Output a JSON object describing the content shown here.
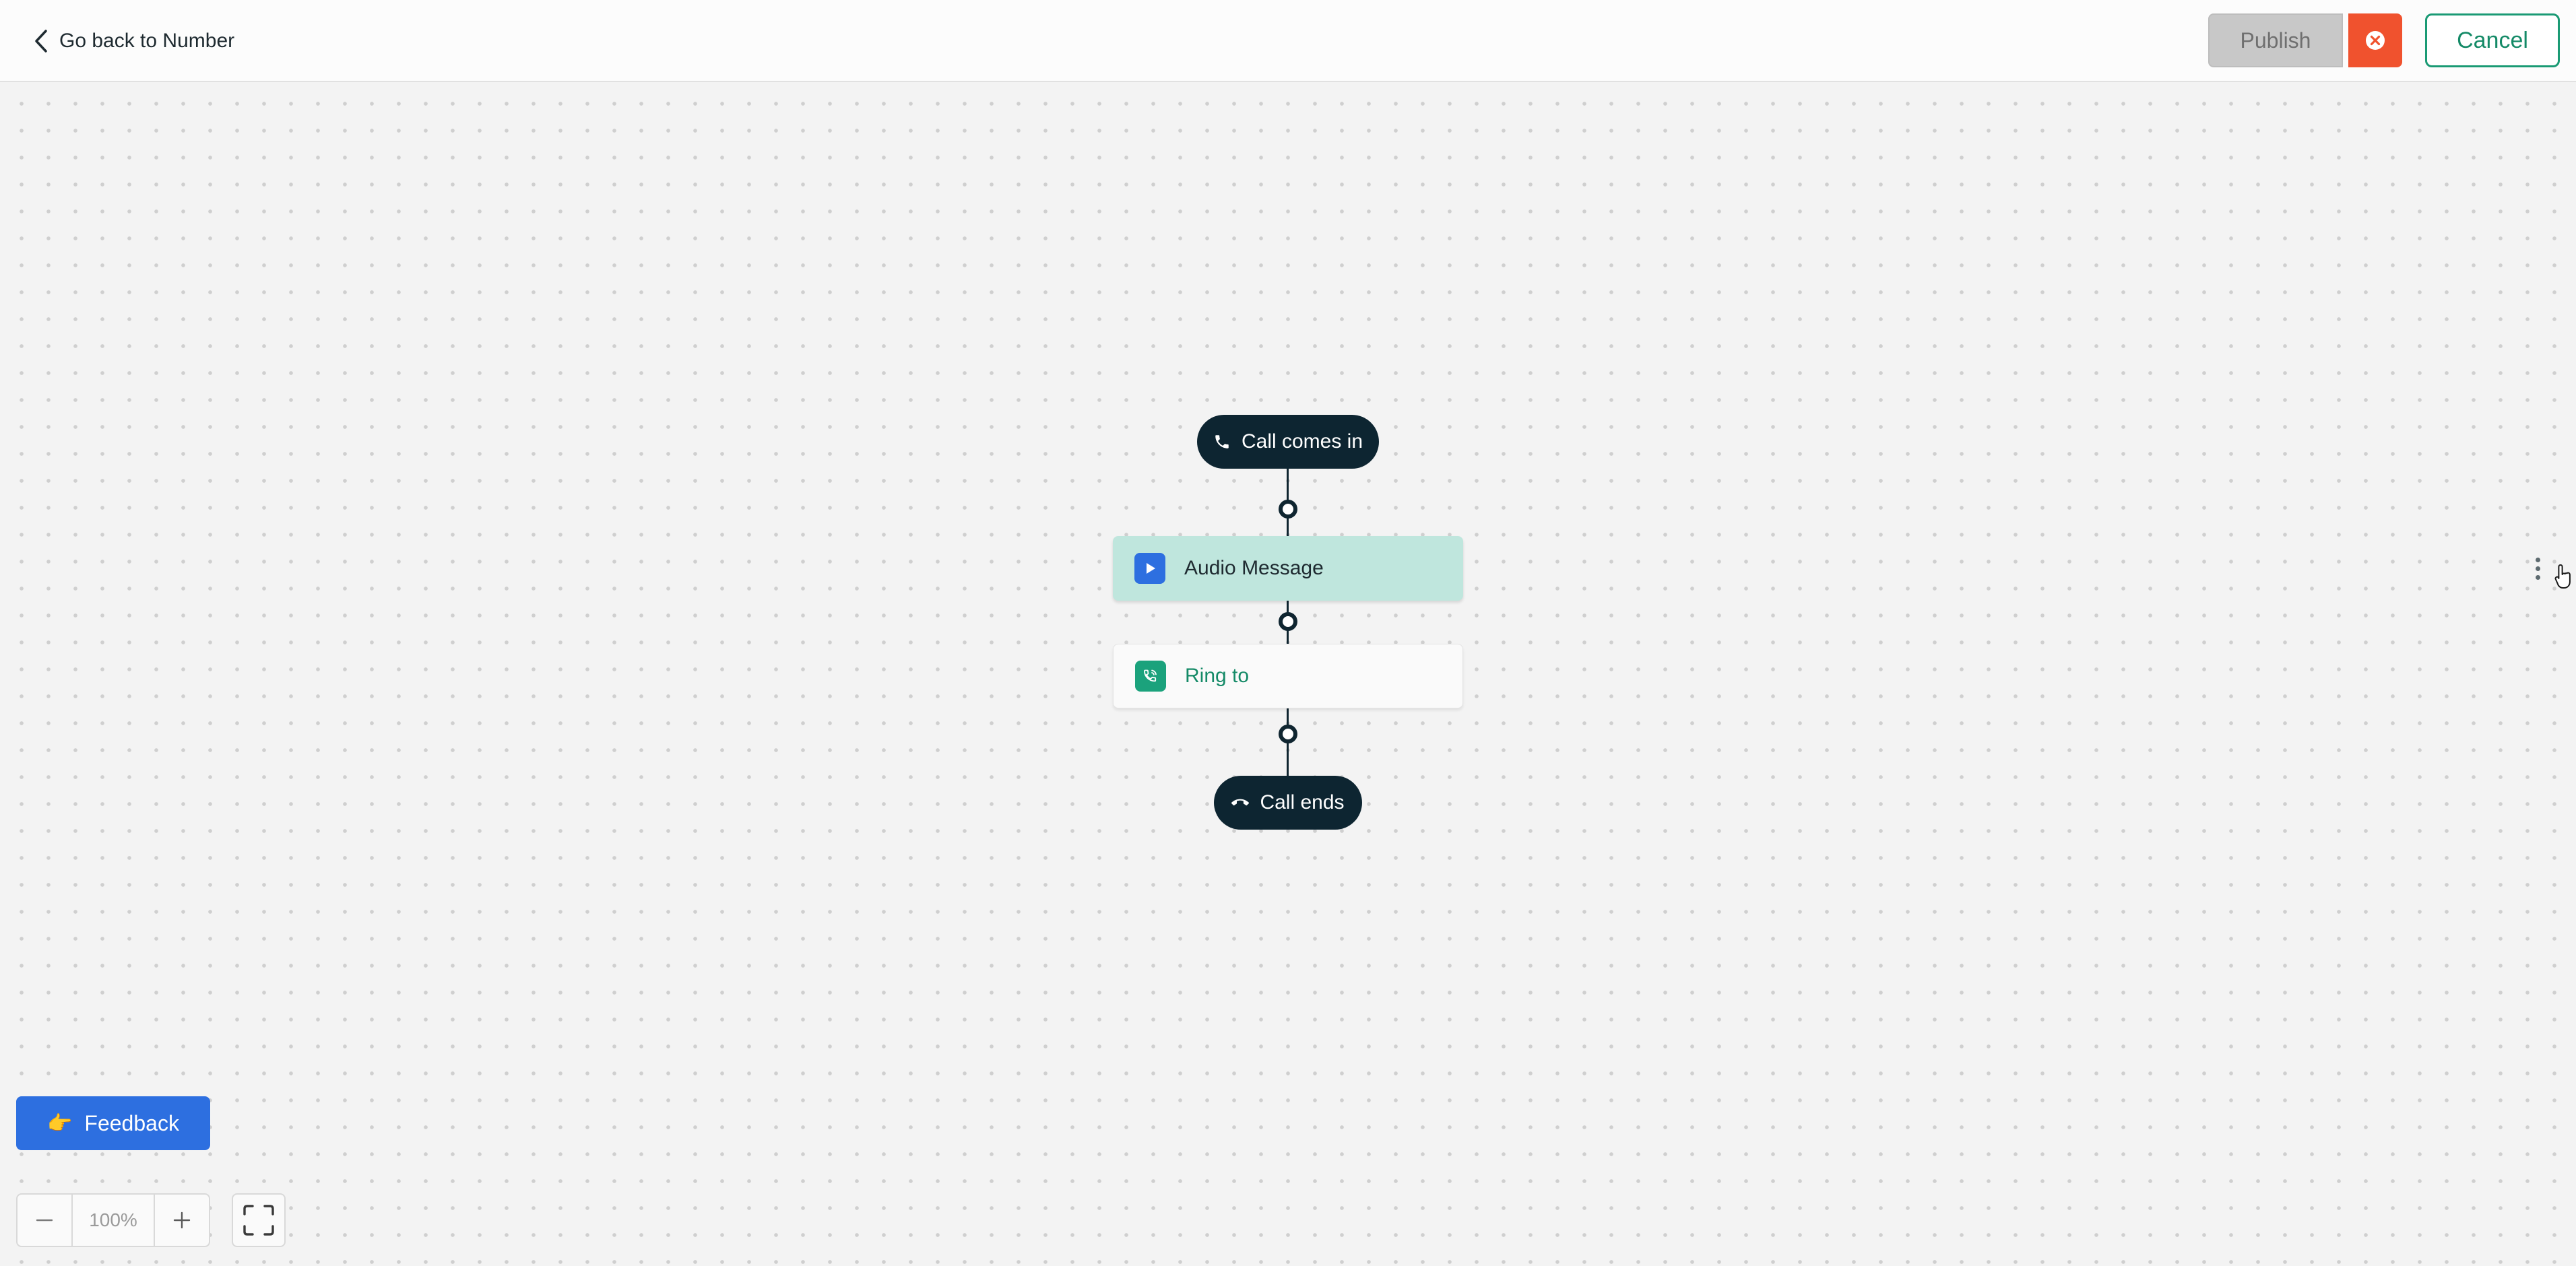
{
  "topbar": {
    "back_label": "Go back to Number",
    "publish_label": "Publish",
    "cancel_label": "Cancel"
  },
  "flow": {
    "start_label": "Call comes in",
    "steps": [
      {
        "label": "Audio Message",
        "icon": "play-icon",
        "state": "selected"
      },
      {
        "label": "Ring to",
        "icon": "phone-ring-icon",
        "state": "default"
      }
    ],
    "end_label": "Call ends"
  },
  "feedback": {
    "label": "Feedback",
    "emoji": "👉"
  },
  "zoom": {
    "value": "100%"
  },
  "colors": {
    "accent_green": "#148a67",
    "dark_navy": "#0d2531",
    "primary_blue": "#2d6fe0",
    "error_red": "#f0522e",
    "selected_node_bg": "#bfe6dd"
  }
}
